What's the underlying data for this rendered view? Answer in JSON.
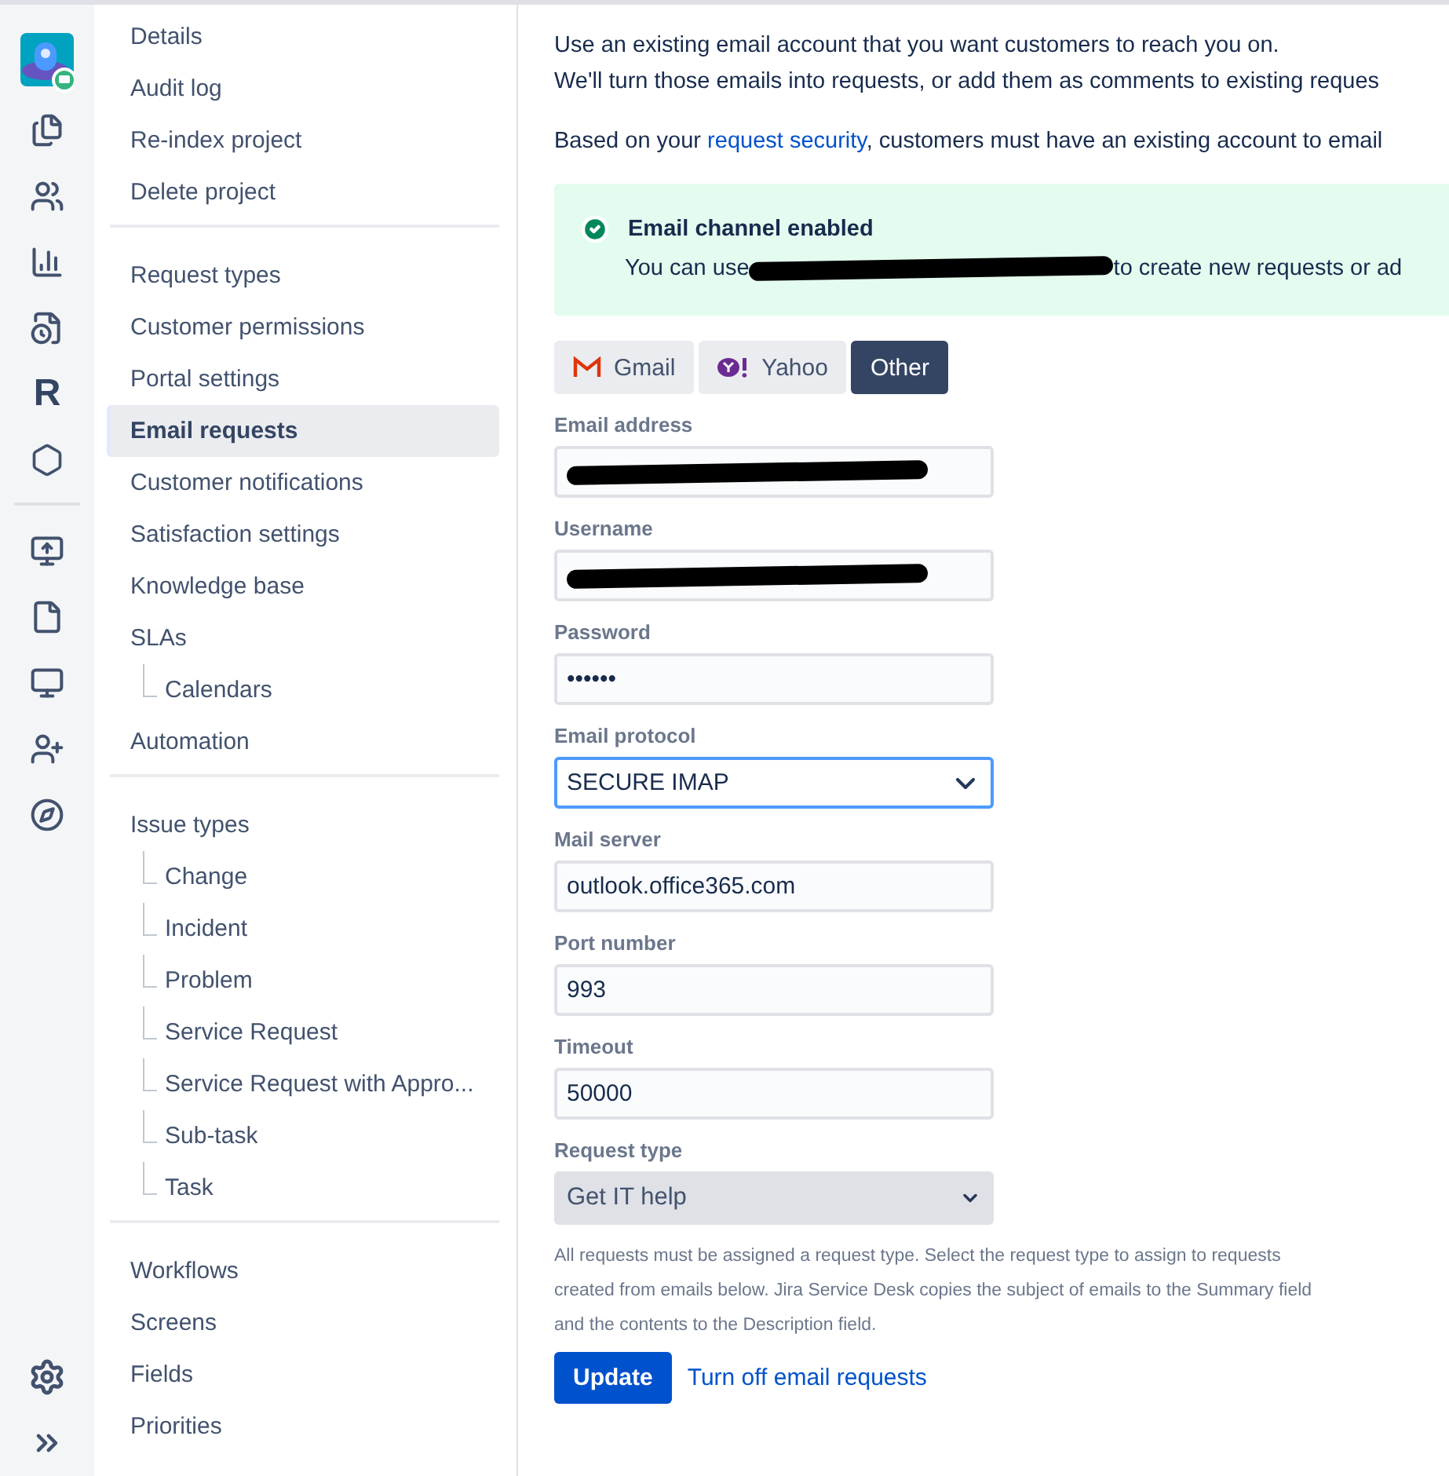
{
  "rail": {
    "logo_text": "R"
  },
  "sidebar": {
    "groups": [
      {
        "items": [
          {
            "label": "Details",
            "selected": false
          },
          {
            "label": "Audit log",
            "selected": false
          },
          {
            "label": "Re-index project",
            "selected": false
          },
          {
            "label": "Delete project",
            "selected": false
          }
        ]
      },
      {
        "items": [
          {
            "label": "Request types",
            "selected": false
          },
          {
            "label": "Customer permissions",
            "selected": false
          },
          {
            "label": "Portal settings",
            "selected": false
          },
          {
            "label": "Email requests",
            "selected": true
          },
          {
            "label": "Customer notifications",
            "selected": false
          },
          {
            "label": "Satisfaction settings",
            "selected": false
          },
          {
            "label": "Knowledge base",
            "selected": false
          },
          {
            "label": "SLAs",
            "selected": false,
            "children": [
              {
                "label": "Calendars",
                "selected": false
              }
            ]
          },
          {
            "label": "Automation",
            "selected": false
          }
        ]
      },
      {
        "items": [
          {
            "label": "Issue types",
            "selected": false,
            "children": [
              {
                "label": "Change",
                "selected": false
              },
              {
                "label": "Incident",
                "selected": false
              },
              {
                "label": "Problem",
                "selected": false
              },
              {
                "label": "Service Request",
                "selected": false
              },
              {
                "label": "Service Request with Appro...",
                "selected": false
              },
              {
                "label": "Sub-task",
                "selected": false
              },
              {
                "label": "Task",
                "selected": false
              }
            ]
          }
        ]
      },
      {
        "items": [
          {
            "label": "Workflows",
            "selected": false
          },
          {
            "label": "Screens",
            "selected": false
          },
          {
            "label": "Fields",
            "selected": false
          },
          {
            "label": "Priorities",
            "selected": false
          }
        ]
      }
    ]
  },
  "intro": [
    "Use an existing email account that you want customers to reach you on.",
    "We'll turn those emails into requests, or add them as comments to existing reques"
  ],
  "security": {
    "before": "Based on your ",
    "link": "request security",
    "after": ", customers must have an existing account to email"
  },
  "banner": {
    "title": "Email channel enabled",
    "message_before": "You can use ",
    "redacted": true,
    "message_after": "to create new requests or ad"
  },
  "providers": [
    {
      "label": "Gmail",
      "kind": "gmail",
      "selected": false
    },
    {
      "label": "Yahoo",
      "kind": "yahoo",
      "selected": false
    },
    {
      "label": "Other",
      "kind": "other",
      "selected": true
    }
  ],
  "fields": [
    {
      "label": "Email address",
      "kind": "text",
      "redacted": true
    },
    {
      "label": "Username",
      "kind": "text",
      "redacted": true
    },
    {
      "label": "Password",
      "kind": "text",
      "value": "••••••"
    },
    {
      "label": "Email protocol",
      "kind": "select",
      "value": "SECURE IMAP",
      "focused": true
    },
    {
      "label": "Mail server",
      "kind": "text",
      "value": "outlook.office365.com"
    },
    {
      "label": "Port number",
      "kind": "text",
      "value": "993"
    },
    {
      "label": "Timeout",
      "kind": "text",
      "value": "50000"
    },
    {
      "label": "Request type",
      "kind": "native-select",
      "value": "Get IT help"
    }
  ],
  "help_text": "All requests must be assigned a request type. Select the request type to assign to requests created from emails below. Jira Service Desk copies the subject of emails to the Summary field and the contents to the Description field.",
  "actions": {
    "primary": "Update",
    "link": "Turn off email requests"
  }
}
